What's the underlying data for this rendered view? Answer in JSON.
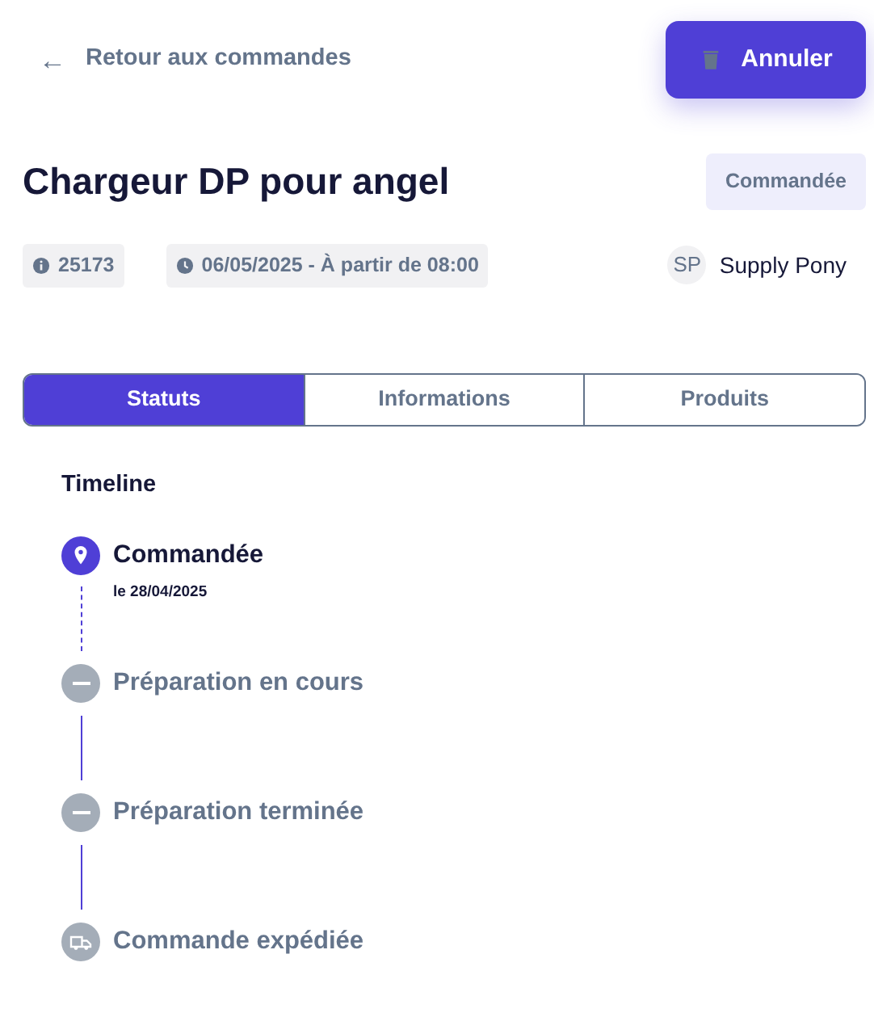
{
  "back_link": {
    "icon": "←",
    "label": "Retour aux commandes"
  },
  "cancel_button": {
    "label": "Annuler"
  },
  "order": {
    "title": "Chargeur DP pour angel",
    "status": "Commandée",
    "id": "25173",
    "date": "06/05/2025 - À partir de 08:00",
    "supplier_initials": "SP",
    "supplier": "Supply Pony"
  },
  "tabs": [
    {
      "label": "Statuts",
      "selected": true
    },
    {
      "label": "Informations",
      "selected": false
    },
    {
      "label": "Produits",
      "selected": false
    }
  ],
  "timeline": {
    "title": "Timeline",
    "steps": [
      {
        "kind": "pin",
        "label": "Commandée",
        "date": "le 28/04/2025",
        "done": true
      },
      {
        "kind": "dash",
        "label": "Préparation en cours",
        "done": false
      },
      {
        "kind": "dash",
        "label": "Préparation terminée",
        "done": false
      },
      {
        "kind": "truck",
        "label": "Commande expédiée",
        "done": false
      }
    ]
  }
}
